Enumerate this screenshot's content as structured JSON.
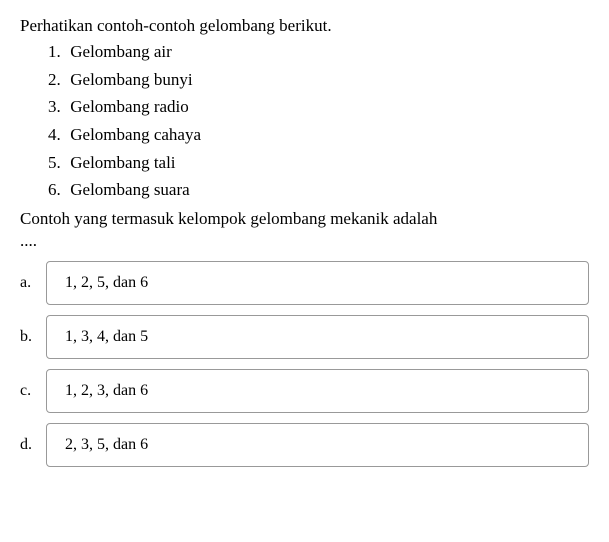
{
  "intro": "Perhatikan contoh-contoh gelombang berikut.",
  "list": [
    {
      "num": "1.",
      "text": "Gelombang air"
    },
    {
      "num": "2.",
      "text": "Gelombang bunyi"
    },
    {
      "num": "3.",
      "text": "Gelombang radio"
    },
    {
      "num": "4.",
      "text": "Gelombang cahaya"
    },
    {
      "num": "5.",
      "text": "Gelombang tali"
    },
    {
      "num": "6.",
      "text": "Gelombang suara"
    }
  ],
  "question": "Contoh yang termasuk kelompok gelombang mekanik adalah",
  "dots": "....",
  "options": [
    {
      "letter": "a.",
      "text": "1, 2, 5, dan 6"
    },
    {
      "letter": "b.",
      "text": "1, 3, 4, dan 5"
    },
    {
      "letter": "c.",
      "text": "1, 2, 3, dan 6"
    },
    {
      "letter": "d.",
      "text": "2, 3, 5, dan 6"
    }
  ]
}
